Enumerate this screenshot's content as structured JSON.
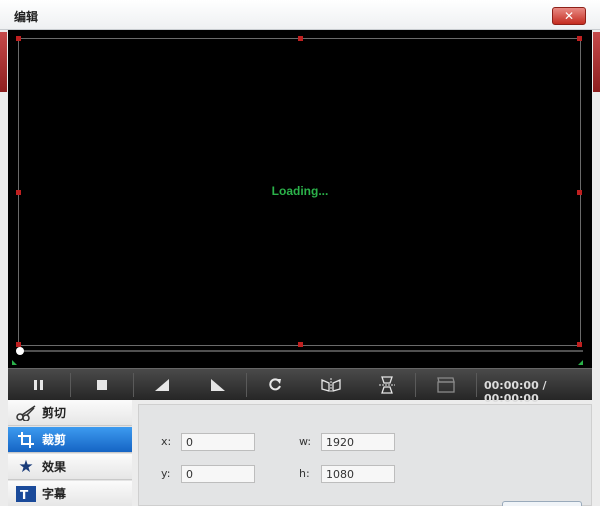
{
  "window": {
    "title": "编辑",
    "close_label": "✕"
  },
  "preview": {
    "status_text": "Loading...",
    "status_color": "#2bb24a",
    "crop_handle_color": "#c02020"
  },
  "toolbar": {
    "tools": [
      {
        "name": "pause-button",
        "icon": "pause-icon"
      },
      {
        "name": "stop-button",
        "icon": "stop-icon"
      },
      {
        "name": "trim-start-button",
        "icon": "wedge-left-icon"
      },
      {
        "name": "trim-end-button",
        "icon": "wedge-right-icon"
      },
      {
        "name": "rotate-button",
        "icon": "rotate-icon"
      },
      {
        "name": "flip-horizontal-button",
        "icon": "flip-horizontal-icon"
      },
      {
        "name": "flip-vertical-button",
        "icon": "flip-vertical-icon"
      },
      {
        "name": "snapshot-button",
        "icon": "clapper-icon"
      }
    ],
    "time": "00:00:00 / 00:00:00"
  },
  "sidebar": {
    "items": [
      {
        "label": "剪切",
        "icon": "scissors-icon"
      },
      {
        "label": "裁剪",
        "icon": "crop-icon",
        "active": true
      },
      {
        "label": "效果",
        "icon": "star-icon"
      },
      {
        "label": "字幕",
        "icon": "text-icon"
      }
    ]
  },
  "crop": {
    "x_label": "x:",
    "x_value": "0",
    "y_label": "y:",
    "y_value": "0",
    "w_label": "w:",
    "w_value": "1920",
    "h_label": "h:",
    "h_value": "1080"
  }
}
